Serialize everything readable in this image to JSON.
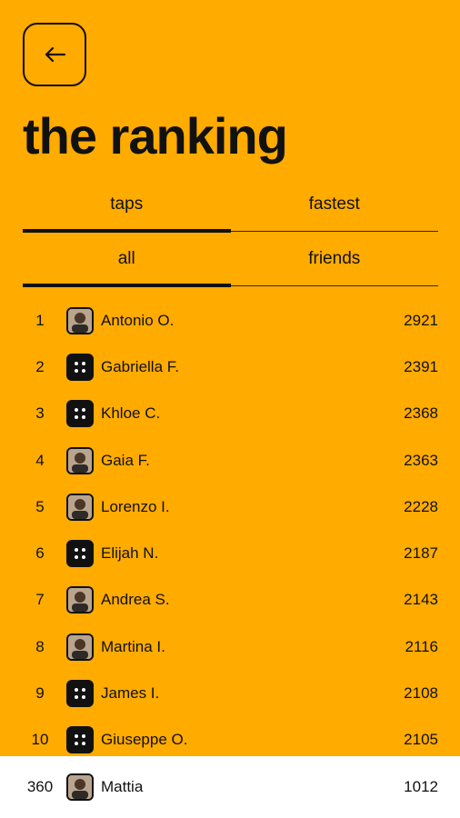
{
  "header": {
    "title": "the ranking",
    "back_icon": "arrow-left-icon"
  },
  "tabs_metric": [
    {
      "label": "taps",
      "active": true
    },
    {
      "label": "fastest",
      "active": false
    }
  ],
  "tabs_scope": [
    {
      "label": "all",
      "active": true
    },
    {
      "label": "friends",
      "active": false
    }
  ],
  "ranking": [
    {
      "rank": "1",
      "name": "Antonio O.",
      "score": "2921",
      "avatar": "photo"
    },
    {
      "rank": "2",
      "name": "Gabriella F.",
      "score": "2391",
      "avatar": "dots"
    },
    {
      "rank": "3",
      "name": "Khloe C.",
      "score": "2368",
      "avatar": "dots"
    },
    {
      "rank": "4",
      "name": "Gaia F.",
      "score": "2363",
      "avatar": "photo"
    },
    {
      "rank": "5",
      "name": "Lorenzo I.",
      "score": "2228",
      "avatar": "photo"
    },
    {
      "rank": "6",
      "name": "Elijah N.",
      "score": "2187",
      "avatar": "dots"
    },
    {
      "rank": "7",
      "name": "Andrea S.",
      "score": "2143",
      "avatar": "photo"
    },
    {
      "rank": "8",
      "name": "Martina I.",
      "score": "2116",
      "avatar": "photo"
    },
    {
      "rank": "9",
      "name": "James I.",
      "score": "2108",
      "avatar": "dots"
    },
    {
      "rank": "10",
      "name": "Giuseppe O.",
      "score": "2105",
      "avatar": "dots"
    }
  ],
  "me": {
    "rank": "360",
    "name": "Mattia",
    "score": "1012",
    "avatar": "photo"
  },
  "colors": {
    "background": "#FFAB00",
    "foreground": "#111111",
    "me_bar": "#FFFFFF"
  }
}
